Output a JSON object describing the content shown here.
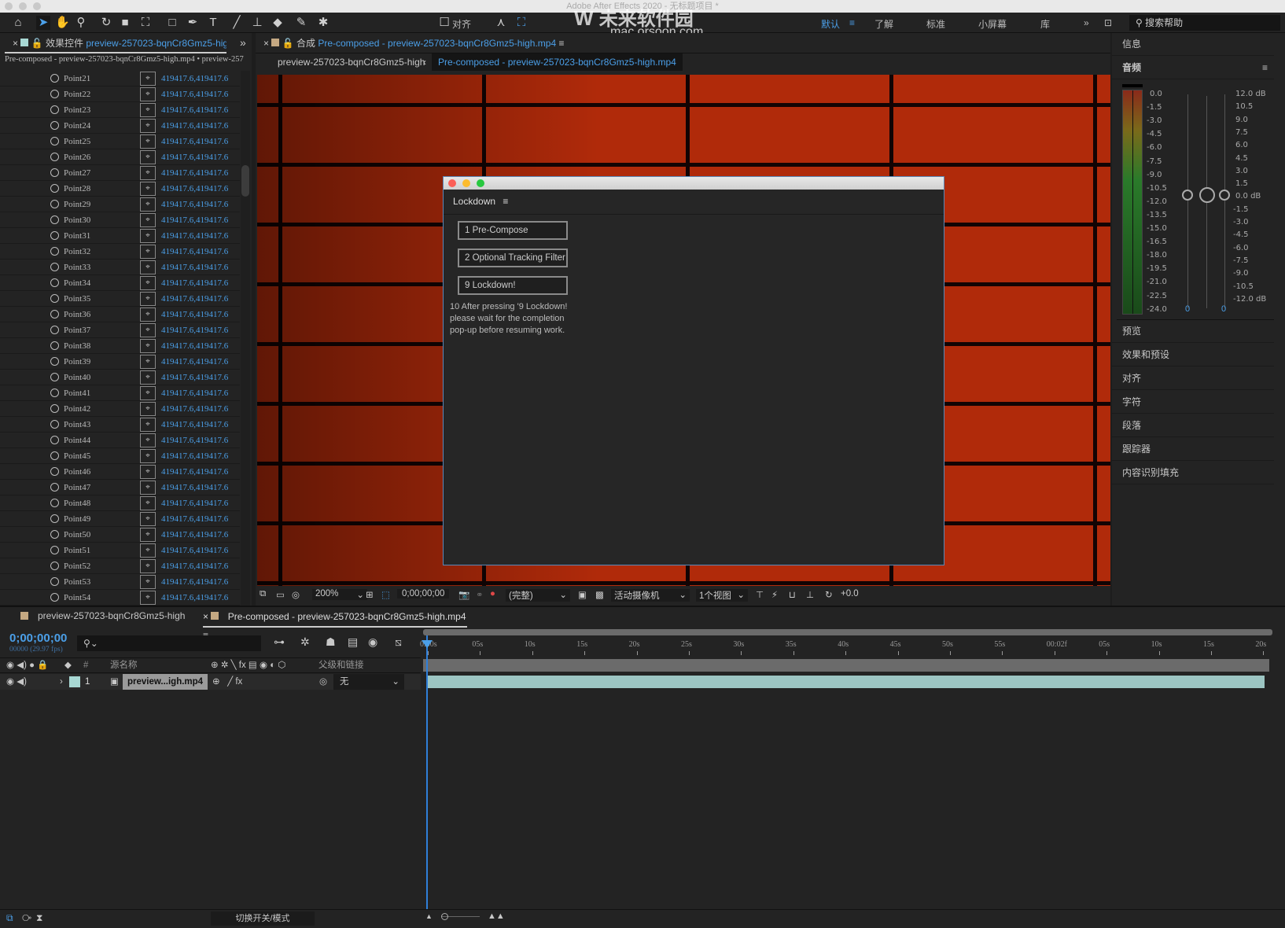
{
  "window": {
    "title": "Adobe After Effects 2020 - 无标题项目 *"
  },
  "watermark": {
    "text": "未来软件园",
    "url_text": "mac.orsoon.com"
  },
  "toolbar": {
    "align_label": "对齐",
    "workspaces": [
      "默认",
      "了解",
      "标准",
      "小屏幕",
      "库"
    ],
    "active_workspace": "默认",
    "search_placeholder": "搜索帮助"
  },
  "effects_panel": {
    "tab_prefix": "效果控件",
    "tab_name": "preview-257023-bqnCr8Gmz5-hig",
    "subtitle": "Pre-composed - preview-257023-bqnCr8Gmz5-high.mp4 • preview-257",
    "points": [
      {
        "name": "Point21",
        "value": "419417.6,419417.6"
      },
      {
        "name": "Point22",
        "value": "419417.6,419417.6"
      },
      {
        "name": "Point23",
        "value": "419417.6,419417.6"
      },
      {
        "name": "Point24",
        "value": "419417.6,419417.6"
      },
      {
        "name": "Point25",
        "value": "419417.6,419417.6"
      },
      {
        "name": "Point26",
        "value": "419417.6,419417.6"
      },
      {
        "name": "Point27",
        "value": "419417.6,419417.6"
      },
      {
        "name": "Point28",
        "value": "419417.6,419417.6"
      },
      {
        "name": "Point29",
        "value": "419417.6,419417.6"
      },
      {
        "name": "Point30",
        "value": "419417.6,419417.6"
      },
      {
        "name": "Point31",
        "value": "419417.6,419417.6"
      },
      {
        "name": "Point32",
        "value": "419417.6,419417.6"
      },
      {
        "name": "Point33",
        "value": "419417.6,419417.6"
      },
      {
        "name": "Point34",
        "value": "419417.6,419417.6"
      },
      {
        "name": "Point35",
        "value": "419417.6,419417.6"
      },
      {
        "name": "Point36",
        "value": "419417.6,419417.6"
      },
      {
        "name": "Point37",
        "value": "419417.6,419417.6"
      },
      {
        "name": "Point38",
        "value": "419417.6,419417.6"
      },
      {
        "name": "Point39",
        "value": "419417.6,419417.6"
      },
      {
        "name": "Point40",
        "value": "419417.6,419417.6"
      },
      {
        "name": "Point41",
        "value": "419417.6,419417.6"
      },
      {
        "name": "Point42",
        "value": "419417.6,419417.6"
      },
      {
        "name": "Point43",
        "value": "419417.6,419417.6"
      },
      {
        "name": "Point44",
        "value": "419417.6,419417.6"
      },
      {
        "name": "Point45",
        "value": "419417.6,419417.6"
      },
      {
        "name": "Point46",
        "value": "419417.6,419417.6"
      },
      {
        "name": "Point47",
        "value": "419417.6,419417.6"
      },
      {
        "name": "Point48",
        "value": "419417.6,419417.6"
      },
      {
        "name": "Point49",
        "value": "419417.6,419417.6"
      },
      {
        "name": "Point50",
        "value": "419417.6,419417.6"
      },
      {
        "name": "Point51",
        "value": "419417.6,419417.6"
      },
      {
        "name": "Point52",
        "value": "419417.6,419417.6"
      },
      {
        "name": "Point53",
        "value": "419417.6,419417.6"
      },
      {
        "name": "Point54",
        "value": "419417.6,419417.6"
      }
    ]
  },
  "composition": {
    "tab_prefix": "合成",
    "tab_name": "Pre-composed - preview-257023-bqnCr8Gmz5-high.mp4",
    "breadcrumb": [
      "preview-257023-bqnCr8Gmz5-high",
      "Pre-composed - preview-257023-bqnCr8Gmz5-high.mp4"
    ],
    "viewer_toolbar": {
      "zoom": "200%",
      "timecode": "0;00;00;00",
      "resolution": "(完整)",
      "camera": "活动摄像机",
      "views": "1个视图",
      "exposure": "+0.0"
    }
  },
  "lockdown": {
    "title": "Lockdown",
    "buttons": [
      "1 Pre-Compose",
      "2 Optional Tracking Filter",
      "9 Lockdown!"
    ],
    "note_lines": [
      "10 After pressing '9 Lockdown!",
      "please wait for the completion",
      "pop-up before resuming work."
    ]
  },
  "right_panel": {
    "info": "信息",
    "audio": "音频",
    "meter_labels": [
      "0.0",
      "-1.5",
      "-3.0",
      "-4.5",
      "-6.0",
      "-7.5",
      "-9.0",
      "-10.5",
      "-12.0",
      "-13.5",
      "-15.0",
      "-16.5",
      "-18.0",
      "-19.5",
      "-21.0",
      "-22.5",
      "-24.0"
    ],
    "db_labels": [
      "12.0 dB",
      "10.5",
      "9.0",
      "7.5",
      "6.0",
      "4.5",
      "3.0",
      "1.5",
      "0.0 dB",
      "-1.5",
      "-3.0",
      "-4.5",
      "-6.0",
      "-7.5",
      "-9.0",
      "-10.5",
      "-12.0 dB"
    ],
    "left_value": "0",
    "right_value": "0",
    "items": [
      "预览",
      "效果和预设",
      "对齐",
      "字符",
      "段落",
      "跟踪器",
      "内容识别填充"
    ]
  },
  "timeline": {
    "tabs": [
      "preview-257023-bqnCr8Gmz5-high",
      "Pre-composed - preview-257023-bqnCr8Gmz5-high.mp4"
    ],
    "active_tab": 1,
    "timecode": "0;00;00;00",
    "frame_info": "00000 (29.97 fps)",
    "col_number": "#",
    "col_source": "源名称",
    "col_parent": "父级和链接",
    "layer": {
      "number": "1",
      "name": "preview...igh.mp4",
      "parent": "无",
      "color": "#a8d8d4"
    },
    "ruler": [
      "0:00s",
      "05s",
      "10s",
      "15s",
      "20s",
      "25s",
      "30s",
      "35s",
      "40s",
      "45s",
      "50s",
      "55s",
      "00:02f",
      "05s",
      "10s",
      "15s",
      "20s"
    ],
    "toggle_label": "切换开关/模式"
  },
  "colors": {
    "accent": "#4b9fe8",
    "layer_bar": "#9cc5c2",
    "viewer_red": "#b02a0a"
  }
}
